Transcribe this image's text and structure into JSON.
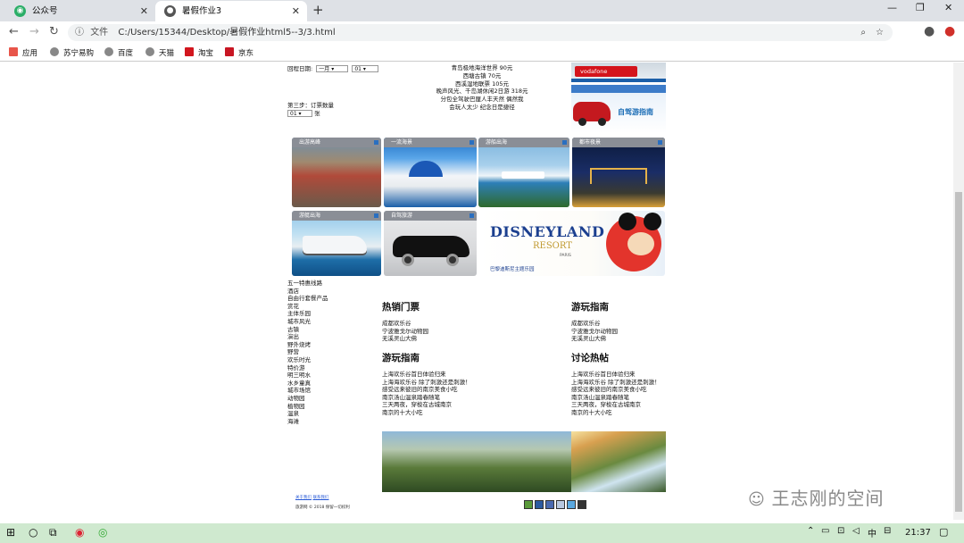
{
  "browser": {
    "tabs": [
      {
        "title": "公众号",
        "icon": "wechat-icon"
      },
      {
        "title": "暑假作业3",
        "icon": "globe-icon"
      }
    ],
    "url_label": "文件",
    "url": "C:/Users/15344/Desktop/暑假作业html5--3/3.html",
    "bookmarks": [
      "应用",
      "苏宁易购",
      "百度",
      "天猫",
      "淘宝",
      "京东"
    ]
  },
  "form": {
    "date_label": "回程日期:",
    "month_value": "一月",
    "day_value": "01",
    "step3_label": "第三步：订票数量",
    "qty_value": "01",
    "qty_unit": "张"
  },
  "promo_lines": [
    "青岛极地海洋世界 90元",
    "西塘古镇 70元",
    "西溪湿地联票 105元",
    "晚声风光、千岛湖休闲2日游 318元",
    "分包全驾驶巴厘人丰天然 偶然我",
    "会玩人太少 纪念日是捷径"
  ],
  "ads": {
    "banner_brand": "vodafone",
    "side_tag": "自驾游指南",
    "side_bar": "自驾游指南"
  },
  "tiles": [
    {
      "label": "出游高峰"
    },
    {
      "label": "一流海景"
    },
    {
      "label": "游船出海"
    },
    {
      "label": "都市夜景"
    },
    {
      "label": "游艇出海"
    },
    {
      "label": "自驾旅游"
    }
  ],
  "disney": {
    "brand": "DISNEYLAND",
    "resort": "RESORT",
    "city": "PARIS",
    "caption": "巴黎迪斯尼主题乐园"
  },
  "left_menu": [
    "五一特惠线路",
    "酒店",
    "自由行套餐产品",
    "赏花",
    "主体乐园",
    "城市风光",
    "古镇",
    "演出",
    "野外烧烤",
    "野营",
    "欢乐时光",
    "特价游",
    "明三明水",
    "水乡童真",
    "城市场馆",
    "动物园",
    "植物园",
    "温泉",
    "海滩"
  ],
  "sections": [
    {
      "title": "热销门票",
      "items": [
        "成都欢乐谷",
        "宁波雅戈尔动物园",
        "无溪灵山大佛"
      ]
    },
    {
      "title": "游玩指南",
      "items": [
        "成都欢乐谷",
        "宁波雅戈尔动物园",
        "无溪灵山大佛"
      ]
    },
    {
      "title": "游玩指南",
      "items": [
        "上海欢乐谷首日体验归来",
        "上海海欢乐谷 除了刺激还是刺激！",
        "感受远来彼旧的南京美食小吃",
        "南京汤山温泉踏春随笔",
        "三天两夜，穿梭在古城南京",
        "南京的十大小吃"
      ]
    },
    {
      "title": "讨论热帖",
      "items": [
        "上海欢乐谷首日体验归来",
        "上海海欢乐谷 除了刺激还是刺激！",
        "感受远来彼旧的南京美食小吃",
        "南京汤山温泉踏春随笔",
        "三天两夜，穿梭在古城南京",
        "南京的十大小吃"
      ]
    }
  ],
  "footer": {
    "links": [
      "关于我们",
      "联系我们"
    ],
    "copyright": "旅游网 © 2018 保留一切权利"
  },
  "social_icons": [
    "share-icon-1",
    "share-icon-2",
    "share-icon-3",
    "share-icon-4",
    "share-icon-5",
    "share-icon-6"
  ],
  "watermark": "王志刚的空间",
  "taskbar": {
    "time": "21:37",
    "ime": "中"
  }
}
